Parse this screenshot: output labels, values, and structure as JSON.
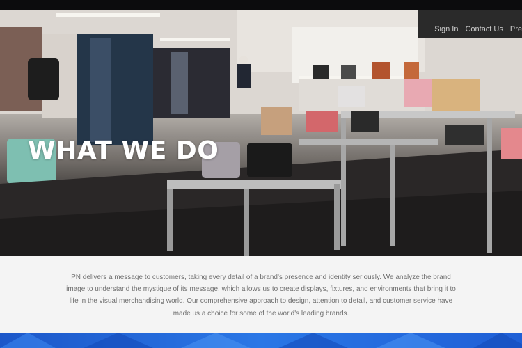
{
  "nav": {
    "items": [
      "Sign In",
      "Contact Us",
      "Pre"
    ]
  },
  "hero": {
    "title": "WHAT WE DO",
    "image_alt_icon": "retail-store-photo"
  },
  "about": {
    "text": "PN delivers a message to customers, taking every detail of a brand's presence and identity seriously. We analyze the brand image to understand the mystique of its message, which allows us to create displays, fixtures, and environments that bring it to life in the visual merchandising world. Our comprehensive approach to design, attention to detail, and customer service have made us a choice for some of the world's leading brands."
  },
  "colors": {
    "topbar": "#0c0c0d",
    "about_bg": "#f4f4f4",
    "about_text": "#6f6f6f",
    "footer_blue": "#2a77e6"
  }
}
